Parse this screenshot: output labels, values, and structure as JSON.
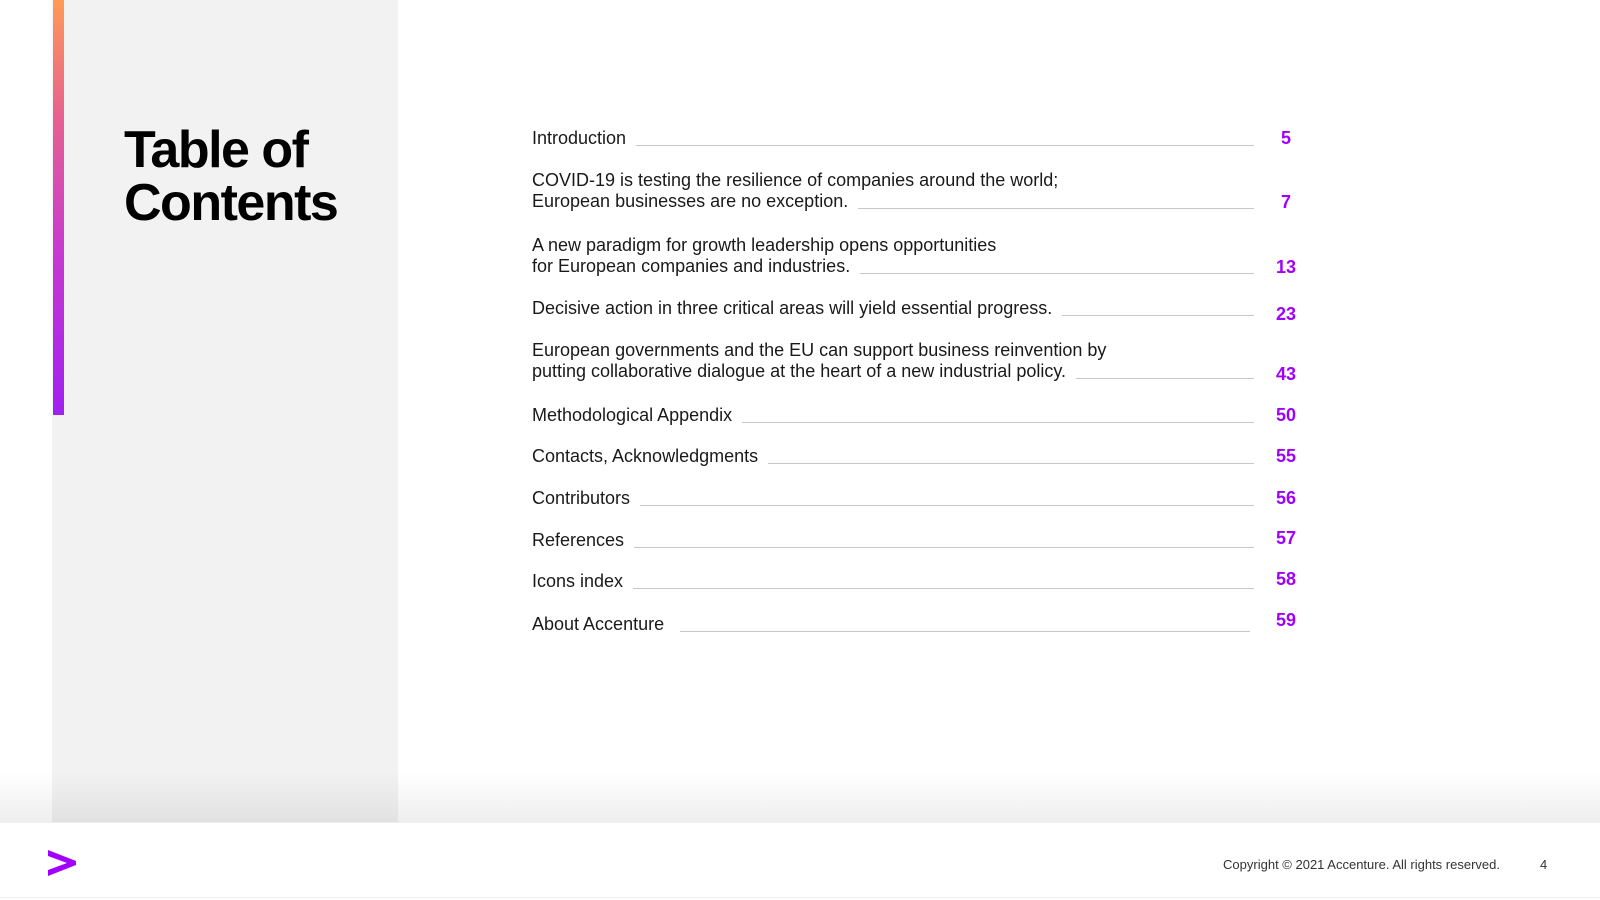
{
  "title": {
    "line1": "Table of",
    "line2": "Contents"
  },
  "toc": [
    {
      "lines": [
        "Introduction"
      ],
      "page": "5"
    },
    {
      "lines": [
        "COVID-19 is testing the resilience of companies around the world;",
        "European businesses are no exception."
      ],
      "page": "7"
    },
    {
      "lines": [
        "A new paradigm for growth leadership opens opportunities",
        "for European companies and industries."
      ],
      "page": "13"
    },
    {
      "lines": [
        "Decisive action in three critical areas will yield essential progress."
      ],
      "page": "23"
    },
    {
      "lines": [
        "European governments and the EU can support business reinvention by",
        "putting collaborative dialogue at the heart of a new industrial policy."
      ],
      "page": "43"
    },
    {
      "lines": [
        "Methodological Appendix"
      ],
      "page": "50"
    },
    {
      "lines": [
        "Contacts, Acknowledgments"
      ],
      "page": "55"
    },
    {
      "lines": [
        "Contributors"
      ],
      "page": "56"
    },
    {
      "lines": [
        "References"
      ],
      "page": "57"
    },
    {
      "lines": [
        "Icons index"
      ],
      "page": "58"
    },
    {
      "lines": [
        "About Accenture"
      ],
      "page": "59"
    }
  ],
  "footer": {
    "copyright": "Copyright © 2021 Accenture. All rights reserved.",
    "page_number": "4"
  },
  "colors": {
    "accent": "#a100ff",
    "panel": "#f2f2f2"
  },
  "icons": {
    "logo": "accenture-greater-than-logo-icon"
  }
}
